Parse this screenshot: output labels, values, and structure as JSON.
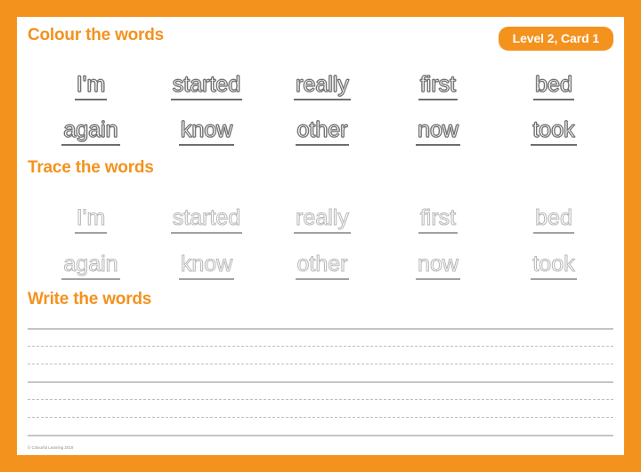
{
  "page": {
    "border_color": "#f4921e",
    "background_color": "#ffffff"
  },
  "badge": {
    "label": "Level 2, Card 1"
  },
  "sections": {
    "colour": {
      "heading": "Colour the words",
      "rows": [
        [
          "I'm",
          "started",
          "really",
          "first",
          "bed"
        ],
        [
          "again",
          "know",
          "other",
          "now",
          "took"
        ]
      ]
    },
    "trace": {
      "heading": "Trace the words",
      "rows": [
        [
          "I'm",
          "started",
          "really",
          "first",
          "bed"
        ],
        [
          "again",
          "know",
          "other",
          "now",
          "took"
        ]
      ]
    },
    "write": {
      "heading": "Write the words",
      "line_groups": 2
    }
  },
  "footer": {
    "copyright": "© Colourful Learning 2019"
  }
}
